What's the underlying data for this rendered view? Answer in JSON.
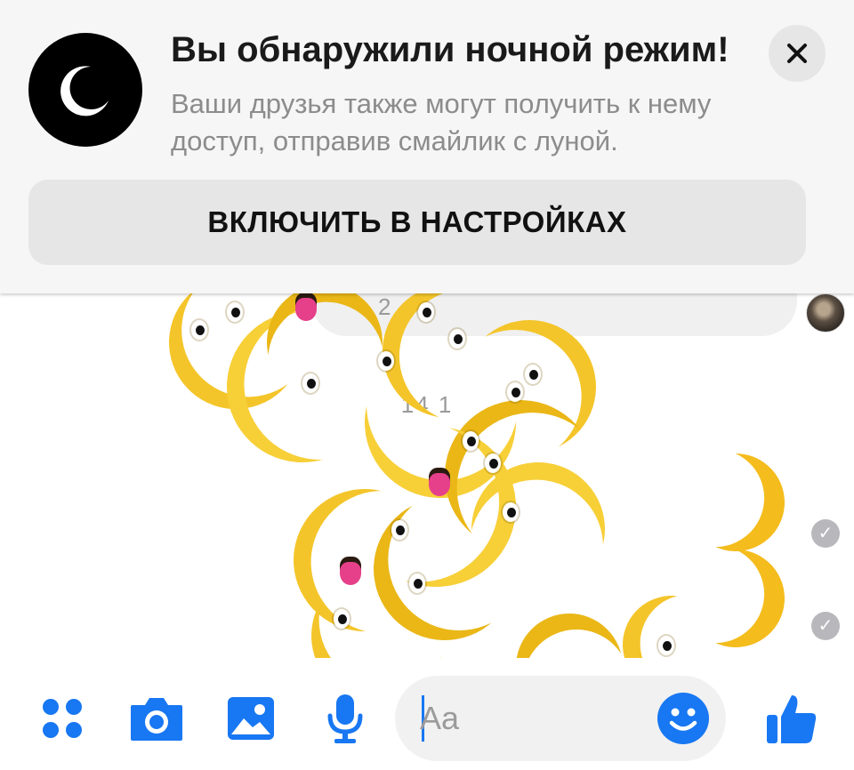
{
  "notice": {
    "title": "Вы обнаружили ночной режим!",
    "text": "Ваши друзья также могут получить к нему доступ, отправив смайлик с луной.",
    "button_label": "ВКЛЮЧИТЬ В НАСТРОЙКАХ",
    "icon": "moon-icon",
    "close_icon": "close-icon"
  },
  "chat": {
    "received_time_partial": "2",
    "timestamp_partial": "14  1",
    "sent_messages": [
      "🌙",
      "🌙"
    ],
    "read_status_icon": "check-circle-icon"
  },
  "composer": {
    "placeholder": "Aa",
    "tools": [
      "menu-dots-icon",
      "camera-icon",
      "gallery-icon",
      "microphone-icon"
    ],
    "emoji_icon": "smiley-icon",
    "like_icon": "thumbs-up-icon"
  },
  "colors": {
    "accent": "#1877f2",
    "moon_yellow": "#f4c52a",
    "tongue_pink": "#e6408a"
  }
}
